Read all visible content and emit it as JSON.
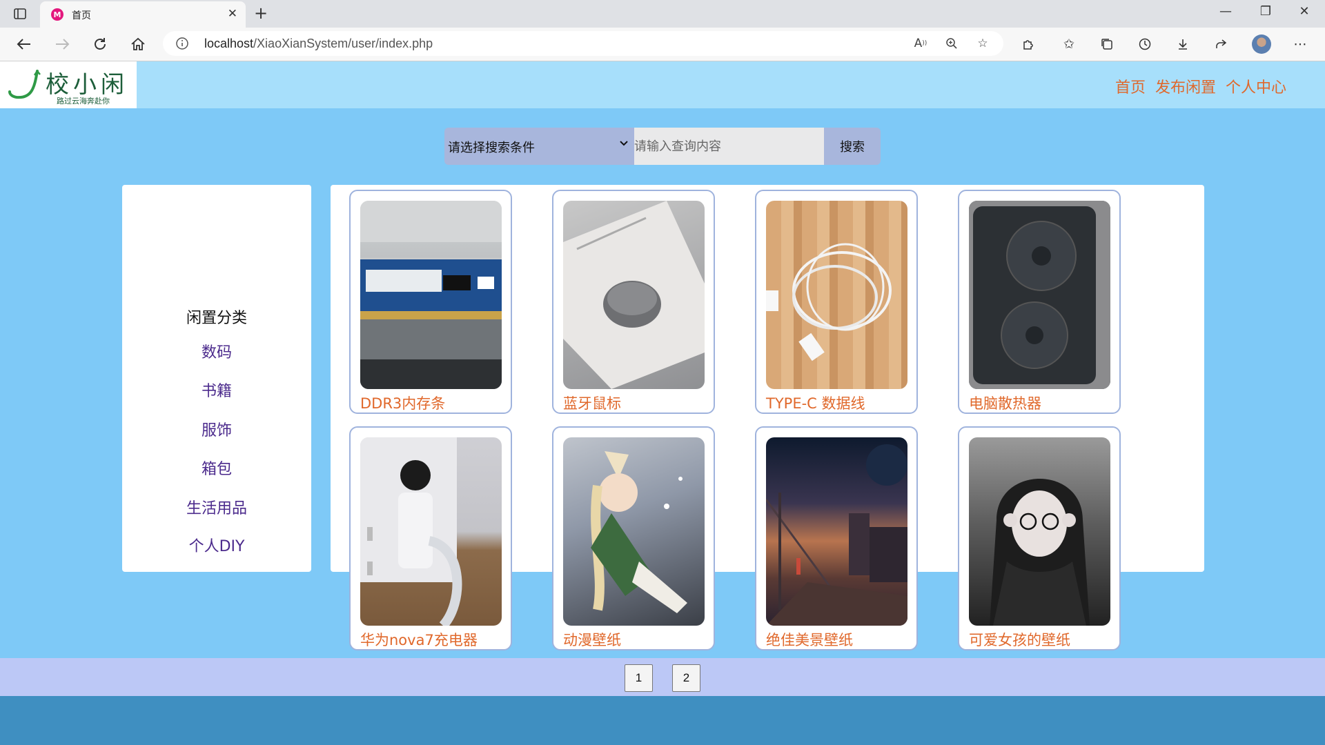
{
  "browser": {
    "tab_title": "首页",
    "favicon_letter": "M",
    "url_host": "localhost",
    "url_path": "/XiaoXianSystem/user/index.php"
  },
  "site": {
    "logo_text": "校小闲",
    "logo_slogan": "路过云海奔赴你",
    "nav": [
      "首页",
      "发布闲置",
      "个人中心"
    ]
  },
  "search": {
    "select_label": "请选择搜索条件",
    "placeholder": "请输入查询内容",
    "button_label": "搜索"
  },
  "sidebar": {
    "title": "闲置分类",
    "items": [
      "数码",
      "书籍",
      "服饰",
      "箱包",
      "生活用品",
      "个人DIY"
    ]
  },
  "products": [
    {
      "name": "DDR3内存条",
      "image": "ram-stick"
    },
    {
      "name": "蓝牙鼠标",
      "image": "bluetooth-mouse"
    },
    {
      "name": "TYPE-C 数据线",
      "image": "usb-cable"
    },
    {
      "name": "电脑散热器",
      "image": "laptop-cooler"
    },
    {
      "name": "华为nova7充电器",
      "image": "phone-charger"
    },
    {
      "name": "动漫壁纸",
      "image": "anime-wallpaper"
    },
    {
      "name": "绝佳美景壁纸",
      "image": "city-wallpaper"
    },
    {
      "name": "可爱女孩的壁纸",
      "image": "girl-wallpaper"
    }
  ],
  "pagination": [
    "1",
    "2"
  ],
  "colors": {
    "header_bg": "#a7dffb",
    "page_bg": "#7ec9f7",
    "accent_orange": "#e0682b",
    "category_purple": "#4b2a8c",
    "pagination_bg": "#bcc8f6",
    "footer_bg": "#3f8fc1"
  }
}
